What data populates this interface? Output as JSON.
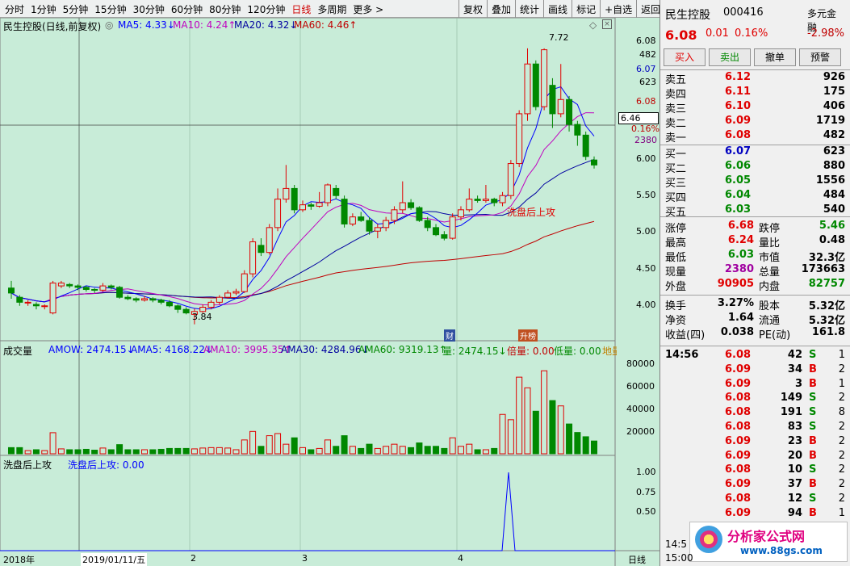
{
  "toolbar": {
    "periods": [
      "分时",
      "1分钟",
      "5分钟",
      "15分钟",
      "30分钟",
      "60分钟",
      "80分钟",
      "120分钟",
      "日线",
      "多周期",
      "更多 >"
    ],
    "active": "日线",
    "right": [
      "复权",
      "叠加",
      "统计",
      "画线",
      "标记",
      "+自选",
      "返回"
    ]
  },
  "main_header": {
    "title": "民生控股(日线,前复权)",
    "ma5": "MA5: 4.33↓",
    "ma10": "MA10: 4.24↑",
    "ma20": "MA20: 4.32↓",
    "ma60": "MA60: 4.46↑"
  },
  "vol_header": {
    "title": "成交量",
    "amow": "AMOW: 2474.15↓",
    "ama5": "AMA5: 4168.22↓",
    "ama10": "AMA10: 3995.35↑",
    "ama30": "AMA30: 4284.96↓",
    "ama60": "AMA60: 9319.13↑",
    "liang": "量: 2474.15↓",
    "beiliang": "倍量: 0.00",
    "diliang": "低量: 0.00",
    "diliang2": "地量"
  },
  "ind_header": {
    "title": "洗盘后上攻",
    "value": "洗盘后上攻: 0.00"
  },
  "annotations": {
    "high": "7.72",
    "low": "3.84",
    "signal": "洗盘后上攻",
    "cai": "财",
    "shengbang": "升榜"
  },
  "price_axis": [
    "6.08",
    "482",
    "6.07",
    "623",
    "6.08",
    "6.46",
    "0.16%",
    "2380",
    "6.00",
    "5.50",
    "5.00",
    "4.50",
    "4.00"
  ],
  "vol_axis": [
    "80000",
    "60000",
    "40000",
    "20000"
  ],
  "ind_axis": [
    "1.00",
    "0.75",
    "0.50"
  ],
  "time_axis": {
    "year": "2018年",
    "date": "2019/01/11/五",
    "m2": "2",
    "m3": "3",
    "m4": "4",
    "period": "日线"
  },
  "colors": {
    "up": "#e00000",
    "down": "#008800",
    "ma5": "#0000ff",
    "ma10": "#c000c0",
    "ma20": "#0000a0",
    "ma60": "#c00000",
    "bg": "#c8ecd8"
  },
  "chart_data": {
    "type": "candlestick",
    "ylim": [
      3.7,
      7.9
    ],
    "candles": [
      [
        4.35,
        4.28,
        4.45,
        4.2
      ],
      [
        4.22,
        4.15,
        4.25,
        4.1
      ],
      [
        4.15,
        4.15,
        4.18,
        4.1
      ],
      [
        4.12,
        4.1,
        4.15,
        4.05
      ],
      [
        4.1,
        4.1,
        4.12,
        4.05
      ],
      [
        4.0,
        4.42,
        4.45,
        3.98
      ],
      [
        4.38,
        4.42,
        4.45,
        4.35
      ],
      [
        4.4,
        4.38,
        4.42,
        4.35
      ],
      [
        4.38,
        4.36,
        4.4,
        4.32
      ],
      [
        4.36,
        4.33,
        4.38,
        4.3
      ],
      [
        4.33,
        4.32,
        4.35,
        4.28
      ],
      [
        4.32,
        4.38,
        4.42,
        4.3
      ],
      [
        4.38,
        4.36,
        4.4,
        4.33
      ],
      [
        4.36,
        4.22,
        4.38,
        4.2
      ],
      [
        4.22,
        4.2,
        4.25,
        4.18
      ],
      [
        4.2,
        4.18,
        4.22,
        4.15
      ],
      [
        4.18,
        4.2,
        4.24,
        4.16
      ],
      [
        4.2,
        4.18,
        4.22,
        4.15
      ],
      [
        4.18,
        4.15,
        4.2,
        4.12
      ],
      [
        4.15,
        4.1,
        4.18,
        4.08
      ],
      [
        4.1,
        4.05,
        4.12,
        4.0
      ],
      [
        4.05,
        4.0,
        4.08,
        3.98
      ],
      [
        3.98,
        4.02,
        4.06,
        3.84
      ],
      [
        4.02,
        4.08,
        4.12,
        4.0
      ],
      [
        4.08,
        4.15,
        4.18,
        4.05
      ],
      [
        4.15,
        4.22,
        4.25,
        4.12
      ],
      [
        4.22,
        4.28,
        4.32,
        4.2
      ],
      [
        4.28,
        4.3,
        4.34,
        4.25
      ],
      [
        4.3,
        4.55,
        4.6,
        4.28
      ],
      [
        4.55,
        5.0,
        5.05,
        4.5
      ],
      [
        4.95,
        4.85,
        5.05,
        4.8
      ],
      [
        4.85,
        5.2,
        5.25,
        4.82
      ],
      [
        5.2,
        5.6,
        5.75,
        5.15
      ],
      [
        5.6,
        5.75,
        6.08,
        5.55
      ],
      [
        5.75,
        5.45,
        5.8,
        5.4
      ],
      [
        5.45,
        5.52,
        5.58,
        5.42
      ],
      [
        5.52,
        5.5,
        5.55,
        5.45
      ],
      [
        5.5,
        5.55,
        5.7,
        5.48
      ],
      [
        5.55,
        5.8,
        5.82,
        5.5
      ],
      [
        5.75,
        5.65,
        5.8,
        5.6
      ],
      [
        5.6,
        5.25,
        5.65,
        5.2
      ],
      [
        5.25,
        5.35,
        5.4,
        5.22
      ],
      [
        5.35,
        5.3,
        5.42,
        5.28
      ],
      [
        5.3,
        5.15,
        5.35,
        5.1
      ],
      [
        5.15,
        5.2,
        5.25,
        5.05
      ],
      [
        5.2,
        5.3,
        5.35,
        5.15
      ],
      [
        5.3,
        5.45,
        5.5,
        5.25
      ],
      [
        5.45,
        5.55,
        5.85,
        5.4
      ],
      [
        5.55,
        5.48,
        5.6,
        5.45
      ],
      [
        5.48,
        5.3,
        5.5,
        5.28
      ],
      [
        5.3,
        5.2,
        5.35,
        5.15
      ],
      [
        5.2,
        5.1,
        5.25,
        5.08
      ],
      [
        5.1,
        5.05,
        5.15,
        5.02
      ],
      [
        5.05,
        5.35,
        5.4,
        5.03
      ],
      [
        5.35,
        5.45,
        5.5,
        5.3
      ],
      [
        5.45,
        5.6,
        5.75,
        5.42
      ],
      [
        5.6,
        5.58,
        5.65,
        5.55
      ],
      [
        5.58,
        5.6,
        5.8,
        5.55
      ],
      [
        5.6,
        5.55,
        5.62,
        5.5
      ],
      [
        5.55,
        5.65,
        5.7,
        5.5
      ],
      [
        5.65,
        6.1,
        6.15,
        5.6
      ],
      [
        6.1,
        6.8,
        6.85,
        6.05
      ],
      [
        6.8,
        7.5,
        7.72,
        6.7
      ],
      [
        7.5,
        6.9,
        7.55,
        6.85
      ],
      [
        6.9,
        7.7,
        7.72,
        6.85
      ],
      [
        7.2,
        6.8,
        7.3,
        6.6
      ],
      [
        6.8,
        7.0,
        7.5,
        6.75
      ],
      [
        7.0,
        6.65,
        7.05,
        6.55
      ],
      [
        6.65,
        6.5,
        6.7,
        6.35
      ],
      [
        6.5,
        6.2,
        6.55,
        6.15
      ],
      [
        6.15,
        6.08,
        6.2,
        6.03
      ]
    ]
  }
}
